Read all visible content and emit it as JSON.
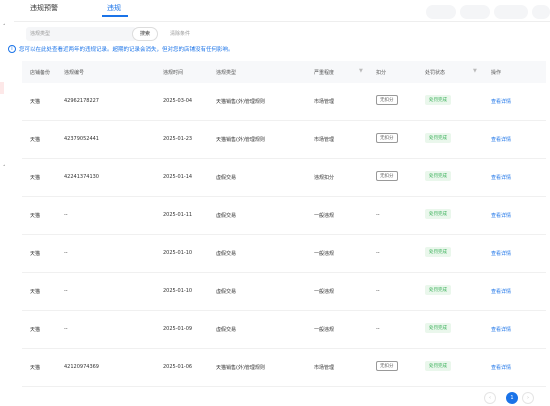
{
  "tabs": [
    {
      "label": "违规预警",
      "active": false
    },
    {
      "label": "违规",
      "active": true
    }
  ],
  "filter": {
    "placeholder": "违规类型",
    "search_label": "搜索",
    "clear_label": "清除条件"
  },
  "notice": "您可以在此处查看近两年的违规记录。超期的记录会消失，但对您的店铺没有任何影响。",
  "table": {
    "headers": [
      "店铺备份",
      "违规编号",
      "违规时间",
      "违规类型",
      "严重程度",
      "扣分",
      "处罚状态",
      "操作"
    ],
    "rows": [
      {
        "shop": "天猫",
        "id": "42962178227",
        "time": "2025-03-04",
        "type": "天猫销售(外)管理规则",
        "severity": "市场管理",
        "points": "无扣分",
        "status": "处罚完成",
        "op": "查看详情"
      },
      {
        "shop": "天猫",
        "id": "42379052441",
        "time": "2025-01-23",
        "type": "天猫销售(外)管理规则",
        "severity": "市场管理",
        "points": "无扣分",
        "status": "处罚完成",
        "op": "查看详情"
      },
      {
        "shop": "天猫",
        "id": "42241374130",
        "time": "2025-01-14",
        "type": "虚假交易",
        "severity": "违规扣分",
        "points": "无扣分",
        "status": "处罚完成",
        "op": "查看详情"
      },
      {
        "shop": "天猫",
        "id": "--",
        "time": "2025-01-11",
        "type": "虚假交易",
        "severity": "一般违规",
        "points": "--",
        "status": "处罚完成",
        "op": "查看详情"
      },
      {
        "shop": "天猫",
        "id": "--",
        "time": "2025-01-10",
        "type": "虚假交易",
        "severity": "一般违规",
        "points": "--",
        "status": "处罚完成",
        "op": "查看详情"
      },
      {
        "shop": "天猫",
        "id": "--",
        "time": "2025-01-10",
        "type": "虚假交易",
        "severity": "一般违规",
        "points": "--",
        "status": "处罚完成",
        "op": "查看详情"
      },
      {
        "shop": "天猫",
        "id": "--",
        "time": "2025-01-09",
        "type": "虚假交易",
        "severity": "一般违规",
        "points": "--",
        "status": "处罚完成",
        "op": "查看详情"
      },
      {
        "shop": "天猫",
        "id": "42120974369",
        "time": "2025-01-06",
        "type": "天猫销售(外)管理规则",
        "severity": "市场管理",
        "points": "无扣分",
        "status": "处罚完成",
        "op": "查看详情"
      }
    ]
  },
  "pagination": {
    "current": "1",
    "prev_icon": "chevron-left-icon",
    "next_icon": "chevron-right-icon"
  },
  "colors": {
    "accent": "#1a73e8",
    "success": "#3bb15a",
    "success_bg": "#eaf7ec"
  }
}
